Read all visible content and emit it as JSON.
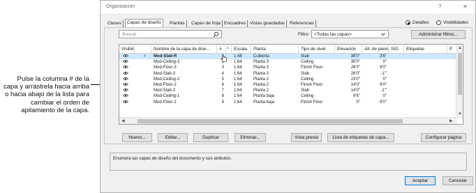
{
  "callout": {
    "text": "Pulse la columna # de la capa y arrástrela hacia arriba o hacia abajo de la lista para cambiar el orden de apilamiento de la capa."
  },
  "window": {
    "title": "Organización",
    "help": "?",
    "close": "✕"
  },
  "tabs": [
    {
      "label": "Clases",
      "active": false
    },
    {
      "label": "Capas de diseño",
      "active": true
    },
    {
      "label": "Plantas",
      "active": false
    },
    {
      "label": "Capas de hoja",
      "active": false
    },
    {
      "label": "Encuadres",
      "active": false
    },
    {
      "label": "Vistas guardadas",
      "active": false
    },
    {
      "label": "Referencias",
      "active": false
    }
  ],
  "view_mode": {
    "details_label": "Detalles",
    "details_selected": true,
    "visibilities_label": "Visibilidades",
    "visibilities_selected": false
  },
  "search": {
    "placeholder": "Buscar",
    "icon": "search-icon"
  },
  "filter": {
    "label": "Filtro:",
    "value": "<Todas las capas>"
  },
  "manage_filters_button": "Administrar filtros...",
  "table": {
    "columns": [
      "Visibili...",
      "",
      "Nombre de la capa de dise...",
      "#",
      "Escala",
      "Planta",
      "Tipo de nivel",
      "Elevación",
      "Alt. de pared",
      "SIG",
      "Etiquetas",
      "P"
    ],
    "sort_indicator": "^",
    "rows": [
      {
        "active": true,
        "name": "Mod-Slab-R",
        "num": "1",
        "scale": "1:48",
        "story": "Cubierta",
        "level_type": "Slab",
        "elevation": "38'0\"",
        "wall_height": "3'6\"",
        "selected": true
      },
      {
        "active": false,
        "name": "Mod-Ceiling-3",
        "num": "2",
        "scale": "1:64",
        "story": "Planta 3",
        "level_type": "Ceiling",
        "elevation": "35'0\"",
        "wall_height": "0\"",
        "selected": false
      },
      {
        "active": false,
        "name": "Mod-Floor-3",
        "num": "3",
        "scale": "1:64",
        "story": "Planta 3",
        "level_type": "Finish Floor",
        "elevation": "26'0\"",
        "wall_height": "9'0\"",
        "selected": false
      },
      {
        "active": false,
        "name": "Mod-Slab-3",
        "num": "4",
        "scale": "1:64",
        "story": "Planta 3",
        "level_type": "Slab",
        "elevation": "26'0\"",
        "wall_height": "-1'\"",
        "selected": false
      },
      {
        "active": false,
        "name": "Mod-Ceiling-2",
        "num": "5",
        "scale": "1:64",
        "story": "Planta 2",
        "level_type": "Ceiling",
        "elevation": "23'0\"",
        "wall_height": "0\"",
        "selected": false
      },
      {
        "active": false,
        "name": "Mod-Floor-2",
        "num": "6",
        "scale": "1:64",
        "story": "Planta 2",
        "level_type": "Finish Floor",
        "elevation": "14'0\"",
        "wall_height": "9'0\"",
        "selected": false
      },
      {
        "active": false,
        "name": "Mod-Slab-2",
        "num": "7",
        "scale": "1:64",
        "story": "Planta 2",
        "level_type": "Slab",
        "elevation": "14'0\"",
        "wall_height": "-1'\"",
        "selected": false
      },
      {
        "active": false,
        "name": "Mod-Ceiling-1",
        "num": "8",
        "scale": "1:64",
        "story": "Planta baja",
        "level_type": "Ceiling",
        "elevation": "9'6\"",
        "wall_height": "0\"",
        "selected": false
      },
      {
        "active": false,
        "name": "Mod-Floor-1",
        "num": "9",
        "scale": "1:64",
        "story": "Planta baja",
        "level_type": "Finish Floor",
        "elevation": "0\"",
        "wall_height": "9'0\"",
        "selected": false
      }
    ]
  },
  "buttons": {
    "new": "Nuevo...",
    "edit": "Editar...",
    "duplicate": "Duplicar",
    "delete": "Eliminar...",
    "preview": "Vista previa",
    "tag_list": "Lista de etiquetas de capa...",
    "page_setup": "Configurar página"
  },
  "description": "Enumera las capas de diseño del documento y sus atributos.",
  "footer": {
    "ok": "Aceptar",
    "cancel": "Cancelar"
  }
}
